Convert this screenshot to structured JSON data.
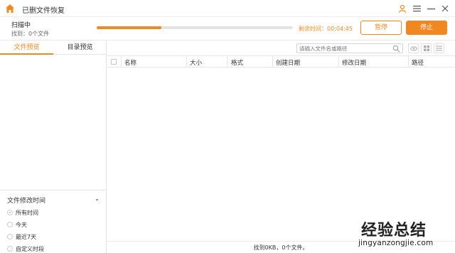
{
  "titlebar": {
    "title": "已删文件恢复",
    "icons": [
      "home-icon",
      "user-icon",
      "menu-icon",
      "minimize-icon",
      "close-icon"
    ],
    "accent": "#ef8a22"
  },
  "scan": {
    "status": "扫描中",
    "found": "找到：0个文件",
    "progress": 0.33,
    "remaining_label": "剩余时间：00:04:45",
    "pause_label": "暂停",
    "stop_label": "停止"
  },
  "left": {
    "tabs": [
      {
        "label": "文件预览",
        "active": true
      },
      {
        "label": "目录预览",
        "active": false
      }
    ],
    "filter": {
      "title": "文件修改时间",
      "options": [
        {
          "label": "所有时间",
          "selected": true
        },
        {
          "label": "今天",
          "selected": false
        },
        {
          "label": "最近7天",
          "selected": false
        },
        {
          "label": "自定义时段",
          "selected": false
        }
      ]
    }
  },
  "right": {
    "search_placeholder": "请输入文件名或路径",
    "view_icons": [
      "eye-icon",
      "grid-view-icon",
      "list-view-icon"
    ],
    "columns": [
      "名称",
      "大小",
      "格式",
      "创建日期",
      "修改日期",
      "路径"
    ],
    "status": "找到0KB，0个文件。"
  },
  "watermark": {
    "cn": "经验总结",
    "url": "jingyanzongjie.com"
  }
}
